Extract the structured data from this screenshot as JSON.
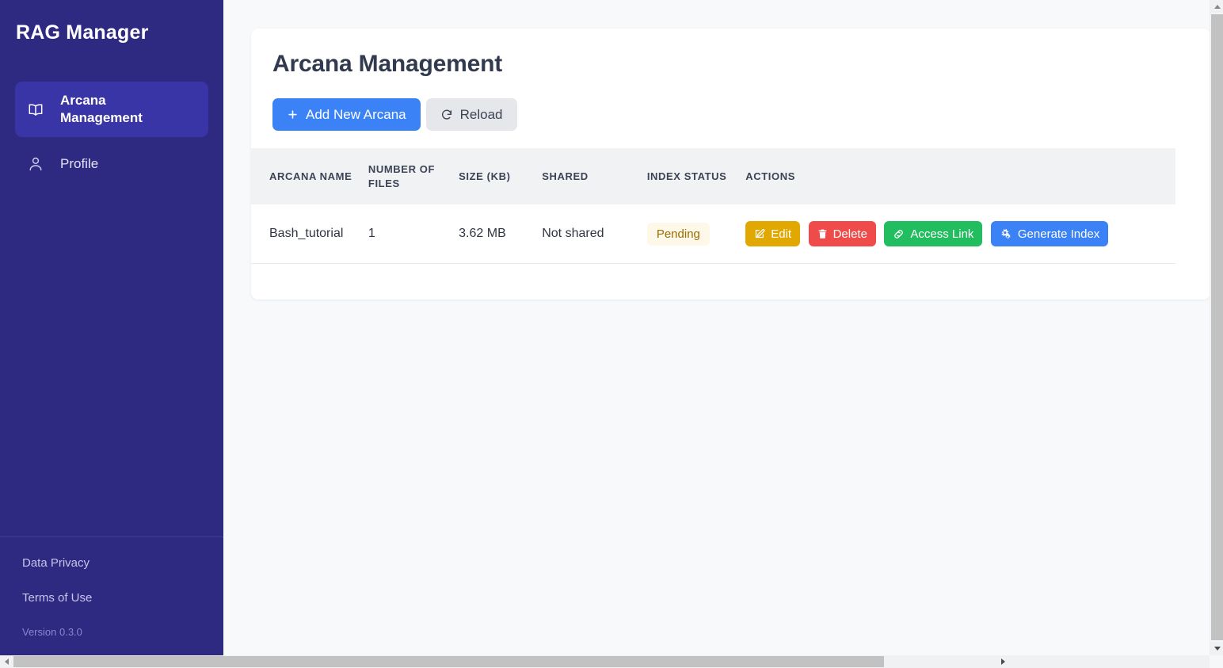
{
  "app": {
    "brand": "RAG Manager",
    "accent_primary": "#3b82f6",
    "sidebar_bg": "#2e2a82",
    "sidebar_active_bg": "#3a35a6"
  },
  "sidebar": {
    "items": [
      {
        "label": "Arcana Management",
        "icon": "book-open-icon",
        "active": true
      },
      {
        "label": "Profile",
        "icon": "user-icon",
        "active": false
      }
    ],
    "footer": {
      "links": [
        {
          "label": "Data Privacy"
        },
        {
          "label": "Terms of Use"
        }
      ],
      "version": "Version 0.3.0"
    }
  },
  "main": {
    "page_title": "Arcana Management",
    "toolbar": {
      "add_label": "Add New Arcana",
      "add_icon": "plus-icon",
      "reload_label": "Reload",
      "reload_icon": "rotate-right-icon"
    },
    "table": {
      "columns": [
        "ARCANA NAME",
        "NUMBER OF FILES",
        "SIZE (KB)",
        "SHARED",
        "INDEX STATUS",
        "ACTIONS"
      ],
      "rows": [
        {
          "name": "Bash_tutorial",
          "number_of_files": "1",
          "size": "3.62 MB",
          "shared": "Not shared",
          "index_status": "Pending",
          "index_status_color": "#9a6d05",
          "actions": [
            {
              "label": "Edit",
              "icon": "pencil-square-icon",
              "color": "#e0a800"
            },
            {
              "label": "Delete",
              "icon": "trash-icon",
              "color": "#ef4b4b"
            },
            {
              "label": "Access Link",
              "icon": "link-icon",
              "color": "#22bd5e"
            },
            {
              "label": "Generate Index",
              "icon": "cogs-icon",
              "color": "#3b82f6"
            }
          ]
        }
      ]
    }
  }
}
